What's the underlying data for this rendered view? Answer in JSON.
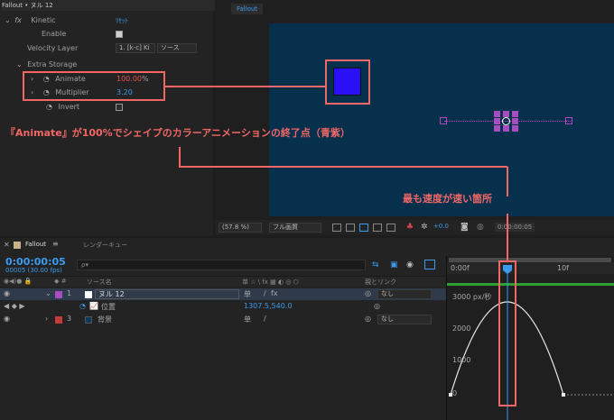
{
  "window_title": "Fallout • ヌル 12",
  "viewer_tab": "Fallout",
  "effect": {
    "name": "Kinetic",
    "reset": "ﾘｾｯﾄ",
    "enable_label": "Enable",
    "velocity_layer_label": "Velocity Layer",
    "velocity_layer_value": "1. [k-c] Ki",
    "velocity_source": "ソース",
    "extra_storage_label": "Extra Storage",
    "animate_label": "Animate",
    "animate_value": "100.00",
    "animate_unit": "%",
    "multiplier_label": "Multiplier",
    "multiplier_value": "3.20",
    "invert_label": "Invert"
  },
  "viewer_toolbar": {
    "zoom": "(57.8 %)",
    "quality": "フル画質",
    "exposure": "+0.0",
    "timecode": "0:00:00:05"
  },
  "timeline": {
    "tab_label": "Fallout",
    "render_queue_label": "レンダーキュー",
    "timecode": "0:00:00:05",
    "frame_info": "00005 (30.00 fps)",
    "search_placeholder": "ρ▾",
    "col_source": "ソース名",
    "col_parent": "親とリンク",
    "layers": [
      {
        "num": "1",
        "name": "ヌル 12",
        "parent": "なし",
        "color": "#a64dbf"
      },
      {
        "num": "3",
        "name": "背景",
        "parent": "なし",
        "color": "#c43a3a"
      }
    ],
    "position_label": "位置",
    "position_value": "1307.5,540.0",
    "ruler": {
      "start": "0:00f",
      "mid": "10f"
    },
    "graph": {
      "top_label": "3000 px/秒",
      "l2000": "2000",
      "l1000": "1000",
      "l0": "0"
    }
  },
  "annotations": {
    "main": "『Animate』が100%でシェイプのカラーアニメーションの終了点（青紫）",
    "speed": "最も速度が速い箇所"
  },
  "colors": {
    "accent_blue": "#3a9bf0",
    "annotation_red": "#f06766",
    "comp_background": "#06304b",
    "square_blue": "#2a10f5"
  }
}
